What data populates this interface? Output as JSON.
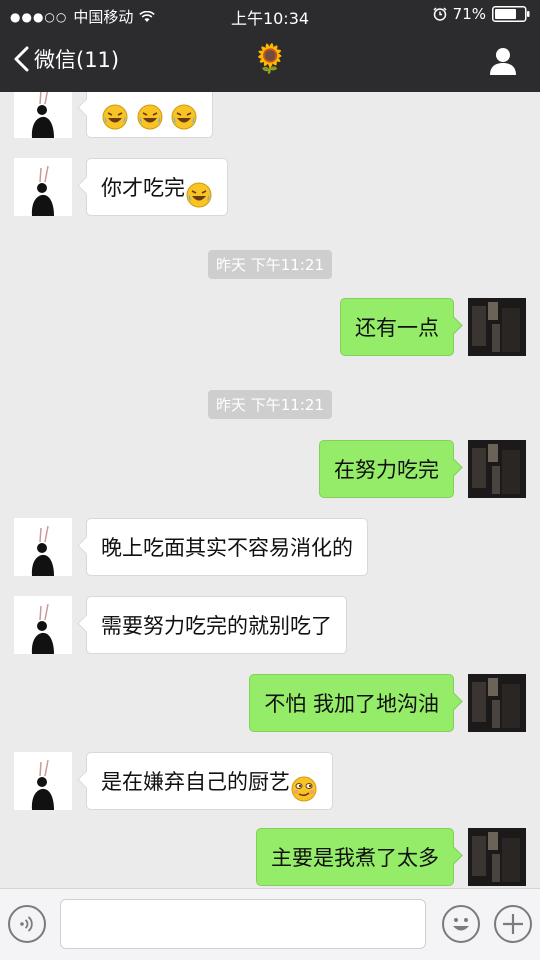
{
  "status_bar": {
    "signal": "●●●○○",
    "carrier": "中国移动",
    "time": "上午10:34",
    "battery": "71%"
  },
  "nav": {
    "back_label": "微信(11)",
    "title_icon": "🌻"
  },
  "messages": [
    {
      "side": "left",
      "text": "",
      "emojis": [
        "laugh-cry-emoji",
        "laugh-cry-emoji",
        "laugh-cry-emoji"
      ]
    },
    {
      "side": "left",
      "text": "你才吃完",
      "emojis": [
        "laugh-cry-emoji"
      ]
    },
    {
      "type": "timestamp",
      "text": "昨天 下午11:21"
    },
    {
      "side": "right",
      "text": "还有一点"
    },
    {
      "type": "timestamp",
      "text": "昨天 下午11:21"
    },
    {
      "side": "right",
      "text": "在努力吃完"
    },
    {
      "side": "left",
      "text": "晚上吃面其实不容易消化的"
    },
    {
      "side": "left",
      "text": "需要努力吃完的就别吃了"
    },
    {
      "side": "right",
      "text": "不怕 我加了地沟油"
    },
    {
      "side": "left",
      "text": "是在嫌弃自己的厨艺",
      "emojis": [
        "smirk-emoji"
      ]
    },
    {
      "side": "right",
      "text": "主要是我煮了太多"
    }
  ],
  "colors": {
    "header_bg": "#2c2c2e",
    "chat_bg": "#ebebeb",
    "sent_bubble": "#95ec69",
    "received_bubble": "#ffffff",
    "timestamp_bg": "#cecece"
  },
  "icons": {
    "wifi": "wifi-icon",
    "alarm": "alarm-icon",
    "battery": "battery-icon",
    "back": "chevron-left-icon",
    "profile": "person-icon",
    "voice": "voice-icon",
    "emoji": "smiley-icon",
    "plus": "plus-icon"
  }
}
